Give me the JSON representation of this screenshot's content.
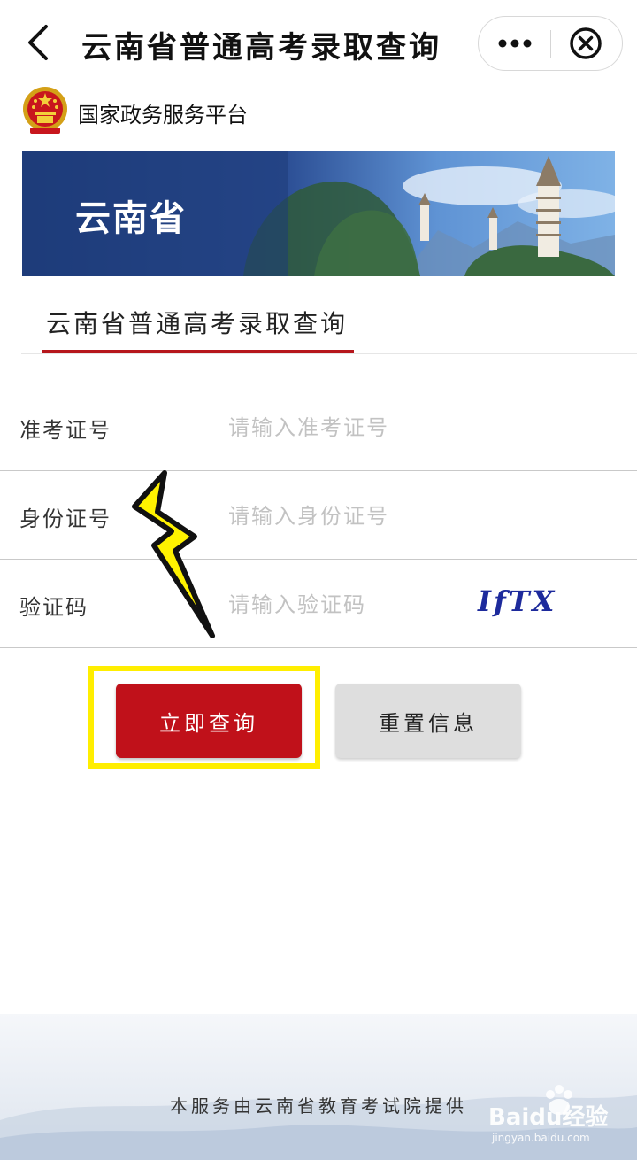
{
  "topbar": {
    "title": "云南省普通高考录取查询"
  },
  "brand": {
    "name": "国家政务服务平台"
  },
  "banner": {
    "text": "云南省"
  },
  "tab": {
    "label": "云南省普通高考录取查询"
  },
  "form": {
    "rows": [
      {
        "label": "准考证号",
        "placeholder": "请输入准考证号",
        "value": ""
      },
      {
        "label": "身份证号",
        "placeholder": "请输入身份证号",
        "value": ""
      },
      {
        "label": "验证码",
        "placeholder": "请输入验证码",
        "value": ""
      }
    ],
    "captcha": "IfTX"
  },
  "buttons": {
    "query_label": "立即查询",
    "reset_label": "重置信息"
  },
  "footer": {
    "text": "本服务由云南省教育考试院提供"
  },
  "watermark": {
    "brand": "Baidu经验",
    "url": "jingyan.baidu.com"
  },
  "colors": {
    "accent_red": "#c0111a",
    "highlight_yellow": "#ffee00",
    "banner_blue": "#2a4d8f",
    "captcha_blue": "#1d2a9c"
  },
  "icons": [
    "back-chevron-icon",
    "more-dots-icon",
    "close-circle-icon",
    "national-emblem-icon",
    "lightning-bolt-icon"
  ]
}
